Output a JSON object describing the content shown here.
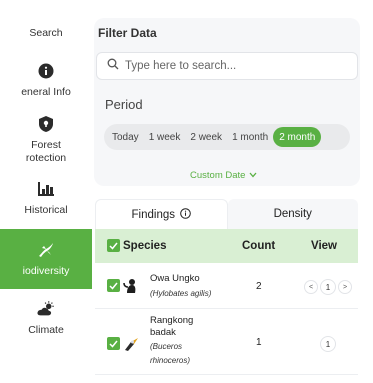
{
  "sidebar": {
    "items": [
      {
        "label": "Search",
        "icon": "search-icon",
        "active": false
      },
      {
        "label": "eneral Info",
        "icon": "info-icon",
        "active": false
      },
      {
        "label": "Forest\nrotection",
        "icon": "shield-icon",
        "active": false
      },
      {
        "label": "Historical",
        "icon": "bar-chart-icon",
        "active": false
      },
      {
        "label": "iodiversity",
        "icon": "biodiversity-icon",
        "active": true
      },
      {
        "label": "Climate",
        "icon": "cloud-sun-icon",
        "active": false
      }
    ]
  },
  "filter": {
    "title": "Filter Data",
    "search_placeholder": "Type here to search...",
    "period_label": "Period",
    "periods": [
      "Today",
      "1 week",
      "2 week",
      "1 month",
      "2 month"
    ],
    "active_period": "2 month",
    "custom_date": "Custom Date"
  },
  "tabs": [
    {
      "label": "Findings",
      "active": true
    },
    {
      "label": "Density",
      "active": false
    }
  ],
  "table": {
    "headers": {
      "species": "Species",
      "count": "Count",
      "view": "View"
    },
    "rows": [
      {
        "name": "Owa Ungko",
        "scientific": "(Hylobates agilis)",
        "count": "2",
        "page": "1"
      },
      {
        "name_lines": [
          "Rangkong",
          "badak"
        ],
        "scientific_lines": [
          "(Buceros",
          "rhinoceros)"
        ],
        "count": "1",
        "page": "1"
      }
    ]
  },
  "colors": {
    "accent": "#59b043",
    "header_bg": "#d9efd3",
    "panel_bg": "#f6f7f9"
  }
}
